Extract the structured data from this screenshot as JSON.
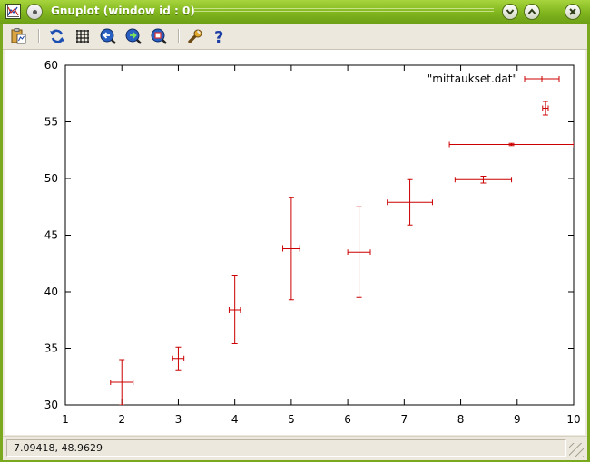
{
  "window": {
    "title": "Gnuplot (window id : 0)"
  },
  "toolbar": {
    "buttons": [
      {
        "name": "copy-to-clipboard",
        "icon": "clipboard-icon"
      },
      {
        "name": "replot",
        "icon": "refresh-icon"
      },
      {
        "name": "toggle-grid",
        "icon": "grid-icon"
      },
      {
        "name": "previous-zoom",
        "icon": "zoom-previous-icon"
      },
      {
        "name": "next-zoom",
        "icon": "zoom-next-icon"
      },
      {
        "name": "autoscale",
        "icon": "zoom-fit-icon"
      },
      {
        "name": "configure",
        "icon": "wrench-icon"
      },
      {
        "name": "help",
        "icon": "help-icon"
      }
    ]
  },
  "status": {
    "coordinates": "7.09418,  48.9629"
  },
  "colors": {
    "series": "#cc0000",
    "titlebar": "#80b51e",
    "frame": "#7aa91f"
  },
  "chart_data": {
    "type": "scatter",
    "style": "xyerrorbars",
    "title": "",
    "xlabel": "",
    "ylabel": "",
    "xlim": [
      1,
      10
    ],
    "ylim": [
      30,
      60
    ],
    "xticks": [
      1,
      2,
      3,
      4,
      5,
      6,
      7,
      8,
      9,
      10
    ],
    "yticks": [
      30,
      35,
      40,
      45,
      50,
      55,
      60
    ],
    "grid": false,
    "legend_position": "top-right",
    "series": [
      {
        "name": "\"mittaukset.dat\"",
        "color": "#cc0000",
        "points": [
          {
            "x": 2.0,
            "y": 32.0,
            "xerr": 0.2,
            "yerr": 2.0
          },
          {
            "x": 3.0,
            "y": 34.1,
            "xerr": 0.1,
            "yerr": 1.0
          },
          {
            "x": 4.0,
            "y": 38.4,
            "xerr": 0.1,
            "yerr": 3.0
          },
          {
            "x": 5.0,
            "y": 43.8,
            "xerr": 0.15,
            "yerr": 4.5
          },
          {
            "x": 6.2,
            "y": 43.5,
            "xerr": 0.2,
            "yerr": 4.0
          },
          {
            "x": 7.1,
            "y": 47.9,
            "xerr": 0.4,
            "yerr": 2.0
          },
          {
            "x": 8.4,
            "y": 49.9,
            "xerr": 0.5,
            "yerr": 0.3
          },
          {
            "x": 8.9,
            "y": 53.0,
            "xerr": 1.1,
            "yerr": 0.1
          },
          {
            "x": 9.5,
            "y": 56.2,
            "xerr": 0.05,
            "yerr": 0.6
          }
        ]
      }
    ]
  }
}
